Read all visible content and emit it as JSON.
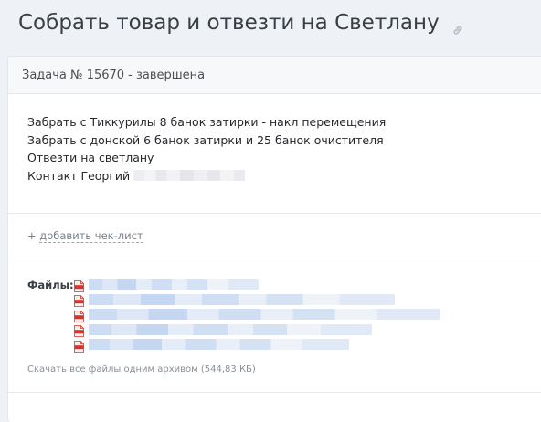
{
  "page": {
    "title": "Собрать товар и отвезти на Светлану"
  },
  "task": {
    "header": "Задача № 15670 - завершена",
    "description_lines": [
      "Забрать с Тиккурилы 8 банок затирки  - накл перемещения",
      "Забрать с донской 6 банок затирки и 25 банок очистителя",
      "Отвезти на светлану",
      "Контакт Георгий"
    ],
    "checklist_add": "+ добавить чек-лист",
    "checklist_add_prefix": "+ ",
    "checklist_add_link": "добавить чек-лист"
  },
  "files": {
    "label": "Файлы:",
    "icon": "pdf-file-icon",
    "count": 5,
    "download_all": "Скачать все файлы одним архивом (544,83 КБ)"
  },
  "colors": {
    "page_background": "#eef1f5",
    "card_background": "#ffffff",
    "pdf_red": "#d9322b"
  }
}
